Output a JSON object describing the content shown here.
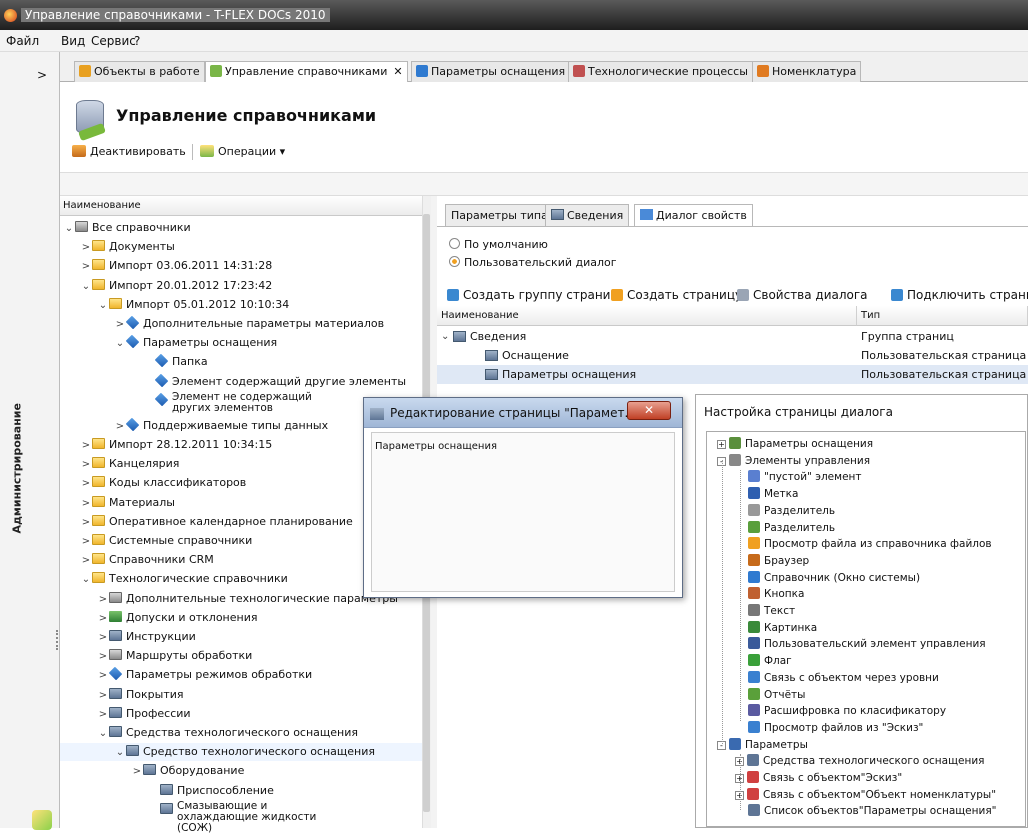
{
  "window": {
    "title": "Управление справочниками - T-FLEX DOCs 2010"
  },
  "menu": {
    "items": [
      "Файл",
      "Вид",
      "Сервис",
      "?"
    ]
  },
  "sidebar": {
    "label": "Администрирование",
    "collapse_glyph": ">"
  },
  "tabs": [
    {
      "label": "Объекты в работе",
      "color": "#e8a020"
    },
    {
      "label": "Управление справочниками",
      "color": "#7ab648",
      "close": "✕"
    },
    {
      "label": "Параметры оснащения",
      "color": "#2f7ad0"
    },
    {
      "label": "Технологические процессы",
      "color": "#c05050"
    },
    {
      "label": "Номенклатура",
      "color": "#e07a20"
    }
  ],
  "header": {
    "title": "Управление справочниками",
    "toolbar": {
      "deactivate": "Деактивировать",
      "operations": "Операции ▾"
    }
  },
  "left_tree": {
    "column_header": "Наименование",
    "rows": [
      {
        "toggle": "⌄",
        "icon": "m",
        "label": "Все справочники",
        "x": 3
      },
      {
        "toggle": ">",
        "icon": "f",
        "label": "Документы",
        "x": 20
      },
      {
        "toggle": ">",
        "icon": "f",
        "label": "Импорт 03.06.2011 14:31:28",
        "x": 20
      },
      {
        "toggle": "⌄",
        "icon": "f",
        "label": "Импорт 20.01.2012 17:23:42",
        "x": 20
      },
      {
        "toggle": "⌄",
        "icon": "f",
        "label": "Импорт 05.01.2012 10:10:34",
        "x": 37
      },
      {
        "toggle": ">",
        "icon": "b",
        "label": "Дополнительные параметры материалов",
        "x": 54
      },
      {
        "toggle": "⌄",
        "icon": "b",
        "label": "Параметры оснащения",
        "x": 54
      },
      {
        "toggle": "",
        "icon": "b",
        "label": "Папка",
        "x": 83
      },
      {
        "toggle": "",
        "icon": "b",
        "label": "Элемент содержащий другие элементы",
        "x": 83
      },
      {
        "toggle": "",
        "icon": "b",
        "label": "Элемент не содержащий других элементов",
        "x": 83,
        "wrap": true
      },
      {
        "toggle": ">",
        "icon": "b",
        "label": "Поддерживаемые типы данных",
        "x": 54
      },
      {
        "toggle": ">",
        "icon": "f",
        "label": "Импорт 28.12.2011 10:34:15",
        "x": 20
      },
      {
        "toggle": ">",
        "icon": "f",
        "label": "Канцелярия",
        "x": 20
      },
      {
        "toggle": ">",
        "icon": "f",
        "label": "Коды классификаторов",
        "x": 20
      },
      {
        "toggle": ">",
        "icon": "f",
        "label": "Материалы",
        "x": 20
      },
      {
        "toggle": ">",
        "icon": "f",
        "label": "Оперативное календарное планирование",
        "x": 20
      },
      {
        "toggle": ">",
        "icon": "f",
        "label": "Системные справочники",
        "x": 20
      },
      {
        "toggle": ">",
        "icon": "f",
        "label": "Справочники CRM",
        "x": 20
      },
      {
        "toggle": "⌄",
        "icon": "f",
        "label": "Технологические справочники",
        "x": 20
      },
      {
        "toggle": ">",
        "icon": "m",
        "label": "Дополнительные технологические параметры",
        "x": 37
      },
      {
        "toggle": ">",
        "icon": "c",
        "label": "Допуски и отклонения",
        "x": 37
      },
      {
        "toggle": ">",
        "icon": "g",
        "label": "Инструкции",
        "x": 37
      },
      {
        "toggle": ">",
        "icon": "m",
        "label": "Маршруты обработки",
        "x": 37
      },
      {
        "toggle": ">",
        "icon": "b",
        "label": "Параметры режимов обработки",
        "x": 37
      },
      {
        "toggle": ">",
        "icon": "g",
        "label": "Покрытия",
        "x": 37
      },
      {
        "toggle": ">",
        "icon": "g",
        "label": "Профессии",
        "x": 37
      },
      {
        "toggle": "⌄",
        "icon": "g",
        "label": "Средства технологического оснащения",
        "x": 37
      },
      {
        "toggle": "⌄",
        "icon": "g",
        "label": "Средство технологического оснащения",
        "x": 54,
        "selected": true
      },
      {
        "toggle": ">",
        "icon": "g",
        "label": "Оборудование",
        "x": 71
      },
      {
        "toggle": "",
        "icon": "g",
        "label": "Приспособление",
        "x": 88
      },
      {
        "toggle": "",
        "icon": "g",
        "label": "Смазывающие и охлаждающие жидкости (СОЖ)",
        "x": 88,
        "wrap": true
      }
    ]
  },
  "right": {
    "tabs": [
      "Параметры типа",
      "Сведения",
      "Диалог свойств"
    ],
    "radio": {
      "default": "По умолчанию",
      "custom": "Пользовательский диалог"
    },
    "toolbar": [
      "Создать группу страниц",
      "Создать страницу",
      "Свойства диалога",
      "Подключить страни"
    ],
    "grid": {
      "headers": [
        "Наименование",
        "Тип"
      ],
      "rows": [
        {
          "name": "Сведения",
          "type": "Группа страниц"
        },
        {
          "name": "Оснащение",
          "type": "Пользовательская страница"
        },
        {
          "name": "Параметры оснащения",
          "type": "Пользовательская страница"
        }
      ]
    }
  },
  "dialog": {
    "title": "Редактирование страницы \"Парамет...",
    "content": "Параметры оснащения",
    "close": "✕"
  },
  "config_panel": {
    "title": "Настройка страницы диалога",
    "items": [
      {
        "label": "Параметры оснащения",
        "pm": "+",
        "level": 0
      },
      {
        "label": "Элементы управления",
        "pm": "-",
        "level": 0
      },
      {
        "label": "\"пустой\" элемент",
        "level": 1
      },
      {
        "label": "Метка",
        "level": 1
      },
      {
        "label": "Разделитель",
        "level": 1
      },
      {
        "label": "Разделитель",
        "level": 1
      },
      {
        "label": "Просмотр файла из справочника файлов",
        "level": 1
      },
      {
        "label": "Браузер",
        "level": 1
      },
      {
        "label": "Справочник (Окно системы)",
        "level": 1
      },
      {
        "label": "Кнопка",
        "level": 1
      },
      {
        "label": "Текст",
        "level": 1
      },
      {
        "label": "Картинка",
        "level": 1
      },
      {
        "label": "Пользовательский элемент управления",
        "level": 1
      },
      {
        "label": "Флаг",
        "level": 1
      },
      {
        "label": "Связь с объектом через уровни",
        "level": 1
      },
      {
        "label": "Отчёты",
        "level": 1
      },
      {
        "label": "Расшифровка по класификатору",
        "level": 1
      },
      {
        "label": "Просмотр файлов из \"Эскиз\"",
        "level": 1
      },
      {
        "label": "Параметры",
        "pm": "-",
        "level": 0
      },
      {
        "label": "Средства технологического оснащения",
        "pm": "+",
        "level": 1
      },
      {
        "label": "Связь с объектом\"Эскиз\"",
        "pm": "+",
        "level": 1
      },
      {
        "label": "Связь с объектом\"Объект номенклатуры\"",
        "pm": "+",
        "level": 1
      },
      {
        "label": "Список объектов\"Параметры оснащения\"",
        "level": 1
      }
    ]
  }
}
